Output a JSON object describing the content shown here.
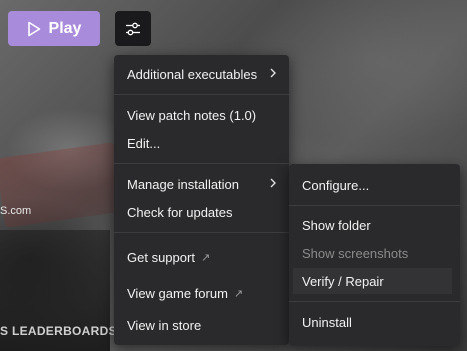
{
  "background": {
    "left_text": "S.com",
    "bottom_text": "S LEADERBOARDS"
  },
  "toolbar": {
    "play_label": "Play",
    "play_color": "#a98bdc",
    "settings_icon": "sliders-icon"
  },
  "main_menu": {
    "items": [
      {
        "label": "Additional executables",
        "submenu": true
      },
      {
        "label": "View patch notes (1.0)"
      },
      {
        "label": "Edit..."
      },
      {
        "label": "Manage installation",
        "submenu": true
      },
      {
        "label": "Check for updates"
      },
      {
        "label": "Get support",
        "external": true
      },
      {
        "label": "View game forum",
        "external": true
      },
      {
        "label": "View in store"
      }
    ]
  },
  "sub_menu": {
    "items": [
      {
        "label": "Configure..."
      },
      {
        "label": "Show folder"
      },
      {
        "label": "Show screenshots",
        "disabled": true
      },
      {
        "label": "Verify / Repair",
        "hovered": true
      },
      {
        "label": "Uninstall"
      }
    ]
  }
}
